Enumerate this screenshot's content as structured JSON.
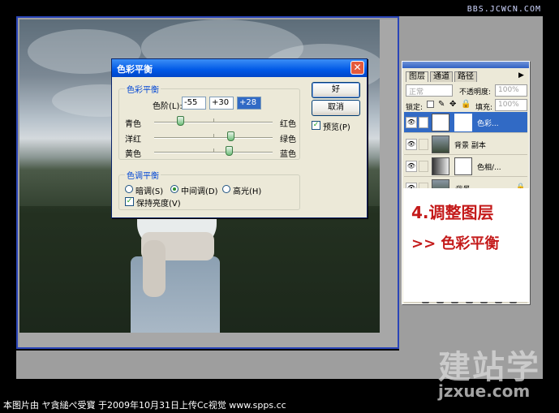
{
  "site_watermark": "BBS.JCWCN.COM",
  "dialog": {
    "title": "色彩平衡",
    "close_label": "✕",
    "color_balance": {
      "group_label": "色彩平衡",
      "levels_label": "色阶(L):",
      "levels": [
        "-55",
        "+30",
        "+28"
      ],
      "rows": [
        {
          "left": "青色",
          "right": "红色",
          "value": -55
        },
        {
          "left": "洋红",
          "right": "绿色",
          "value": 30
        },
        {
          "left": "黄色",
          "right": "蓝色",
          "value": 28
        }
      ]
    },
    "tone_balance": {
      "group_label": "色调平衡",
      "options": [
        "暗调(S)",
        "中间调(D)",
        "高光(H)"
      ],
      "selected": "中间调(D)",
      "preserve_label": "保持亮度(V)",
      "preserve_checked": true
    },
    "ok_label": "好",
    "cancel_label": "取消",
    "preview_label": "预览(P)",
    "preview_checked": true
  },
  "layers_panel": {
    "tabs": [
      "图层",
      "通道",
      "路径"
    ],
    "active_tab": "图层",
    "blend_mode": "正常",
    "opacity_label": "不透明度:",
    "opacity_value": "100%",
    "lock_label": "锁定:",
    "fill_label": "填充:",
    "fill_value": "100%",
    "layers": [
      {
        "name": "色彩...",
        "selected": true
      },
      {
        "name": "背景 副本",
        "selected": false
      },
      {
        "name": "色相/...",
        "selected": false
      },
      {
        "name": "背景",
        "selected": false
      }
    ]
  },
  "annotation": {
    "step": "4.调整图层",
    "sub": ">> 色彩平衡"
  },
  "logo": {
    "text": "建站学",
    "url": "jzxue.com"
  },
  "caption": "本图片由 ヤ貪縋ぺ受寳 于2009年10月31日上传Cc视觉 www.spps.cc",
  "colors": {
    "accent": "#2a45b8",
    "titlebar": "#0058e6",
    "selected_layer": "#316ac5",
    "annotation": "#c41a1a"
  }
}
